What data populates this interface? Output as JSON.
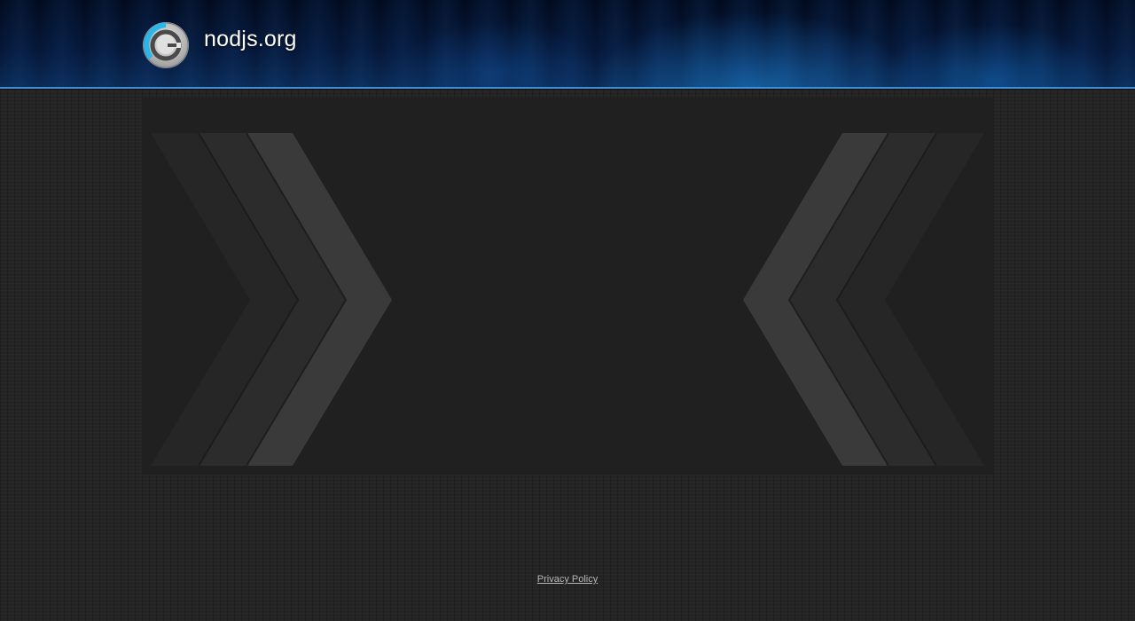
{
  "header": {
    "site_title": "nodjs.org",
    "logo_icon": "circular-refresh-logo-icon",
    "colors": {
      "accent_blue": "#3d8fd6",
      "logo_cyan": "#29b6e8",
      "header_dark": "#020b1f"
    }
  },
  "main": {
    "left_decoration": "chevron-right-decoration",
    "right_decoration": "chevron-left-decoration"
  },
  "footer": {
    "privacy_label": "Privacy Policy"
  }
}
